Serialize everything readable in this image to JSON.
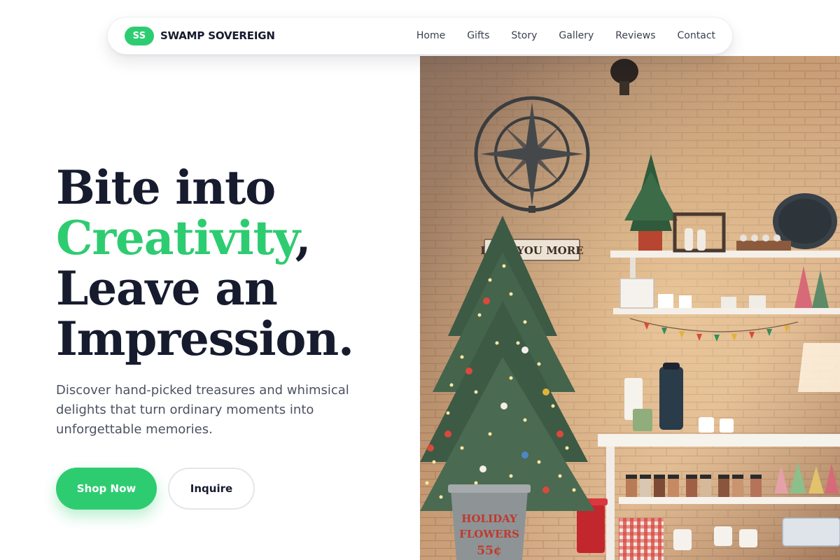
{
  "brand": {
    "badge": "SS",
    "name": "SWAMP SOVEREIGN"
  },
  "nav": {
    "links": [
      "Home",
      "Gifts",
      "Story",
      "Gallery",
      "Reviews",
      "Contact"
    ]
  },
  "hero": {
    "title_line1": "Bite into",
    "title_accent": "Creativity",
    "title_comma": ",",
    "title_line3": "Leave an",
    "title_line4": "Impression.",
    "subtitle": "Discover hand-picked treasures and whimsical delights that turn ordinary moments into unforgettable memories.",
    "primary_button": "Shop Now",
    "secondary_button": "Inquire"
  },
  "image": {
    "wall_sign": "LOVE YOU MORE",
    "bucket_text_1": "HOLIDAY",
    "bucket_text_2": "FLOWERS",
    "bucket_text_3": "55¢"
  },
  "colors": {
    "accent": "#2ecc71",
    "heading": "#161b2e",
    "body_text": "#4d5261",
    "nav_text": "#3b4150"
  },
  "icons": [
    "compass-clock-icon"
  ]
}
